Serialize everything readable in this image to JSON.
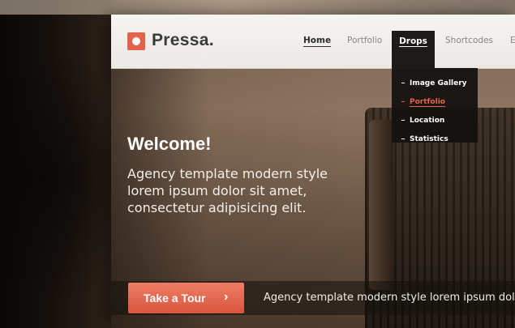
{
  "logo": {
    "text": "Pressa."
  },
  "nav": {
    "items": [
      {
        "label": "Home"
      },
      {
        "label": "Portfolio"
      },
      {
        "label": "Drops"
      },
      {
        "label": "Shortcodes"
      },
      {
        "label": "E"
      }
    ]
  },
  "dropdown": {
    "items": [
      {
        "label": "Image Gallery"
      },
      {
        "label": "Portfolio"
      },
      {
        "label": "Location"
      },
      {
        "label": "Statistics"
      }
    ]
  },
  "hero": {
    "title": "Welcome!",
    "line1": "Agency template modern style",
    "line2": "lorem ipsum dolor sit amet,",
    "line3": "consectetur adipisicing elit."
  },
  "cta": {
    "label": "Take a Tour",
    "arrow": "›"
  },
  "bar": {
    "text": "Agency template modern style lorem ipsum dolor"
  },
  "colors": {
    "accent": "#e2624b",
    "header_bg": "#f6f4f1",
    "dropdown_bg": "#1d1a18"
  }
}
